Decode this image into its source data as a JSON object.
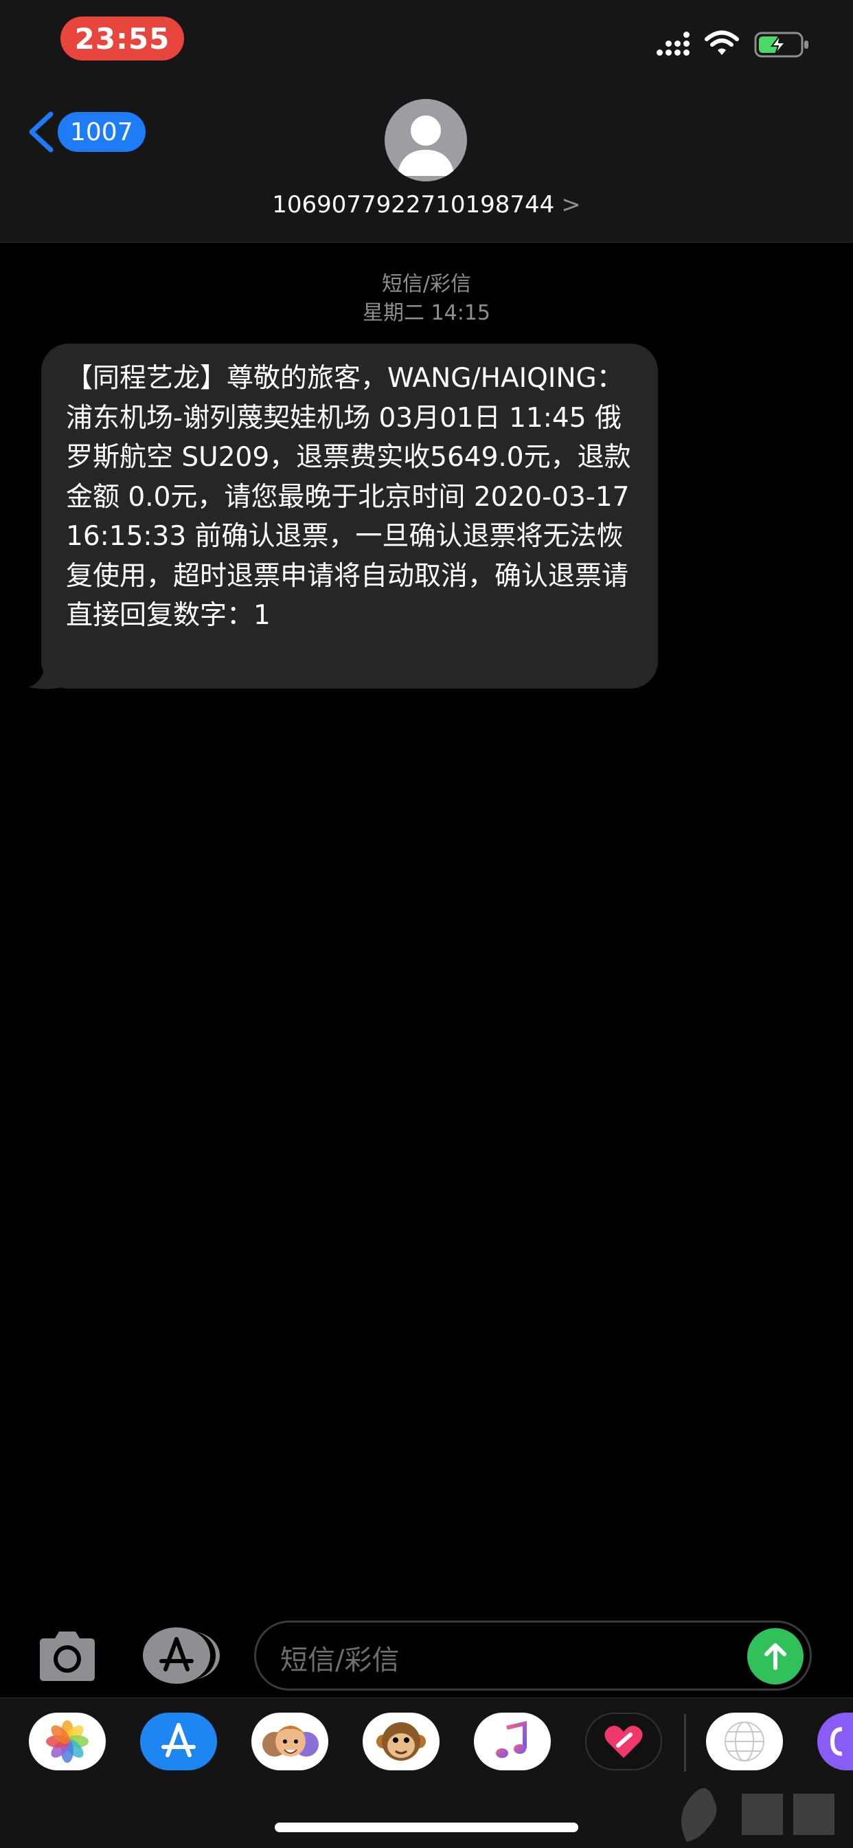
{
  "status_bar": {
    "time": "23:55",
    "signal_icon": "cellular-signal-icon",
    "wifi_icon": "wifi-icon",
    "battery_icon": "battery-charging-icon",
    "time_pill_color": "#E8453C",
    "battery_color": "#4CD964"
  },
  "header": {
    "back_icon": "chevron-left-icon",
    "back_badge": "1007",
    "avatar_icon": "person-icon",
    "contact_number": "1069077922710198744",
    "contact_chevron": ">",
    "accent_color": "#1E7CF7"
  },
  "conversation": {
    "type_label": "短信/彩信",
    "timestamp": "星期二 14:15",
    "messages": [
      {
        "direction": "incoming",
        "text": "【同程艺龙】尊敬的旅客，WANG/HAIQING：浦东机场-谢列蔑契娃机场 03月01日 11:45 俄罗斯航空 SU209，退票费实收5649.0元，退款金额 0.0元，请您最晚于北京时间 2020-03-17 16:15:33 前确认退票，一旦确认退票将无法恢复使用，超时退票申请将自动取消，确认退票请直接回复数字：1"
      }
    ]
  },
  "compose": {
    "camera_icon": "camera-icon",
    "apps_icon": "app-store-icon",
    "placeholder": "短信/彩信",
    "send_icon": "arrow-up-icon",
    "send_color": "#30C15A"
  },
  "app_drawer": {
    "apps": [
      {
        "name": "photos",
        "icon": "photos-icon"
      },
      {
        "name": "app-store",
        "icon": "app-store-icon"
      },
      {
        "name": "memoji",
        "icon": "memoji-icon"
      },
      {
        "name": "animoji",
        "icon": "monkey-icon"
      },
      {
        "name": "music",
        "icon": "music-note-icon"
      },
      {
        "name": "digital-touch",
        "icon": "heart-icon"
      },
      {
        "name": "web-images",
        "icon": "globe-icon"
      },
      {
        "name": "more",
        "icon": "more-app-icon"
      }
    ]
  }
}
